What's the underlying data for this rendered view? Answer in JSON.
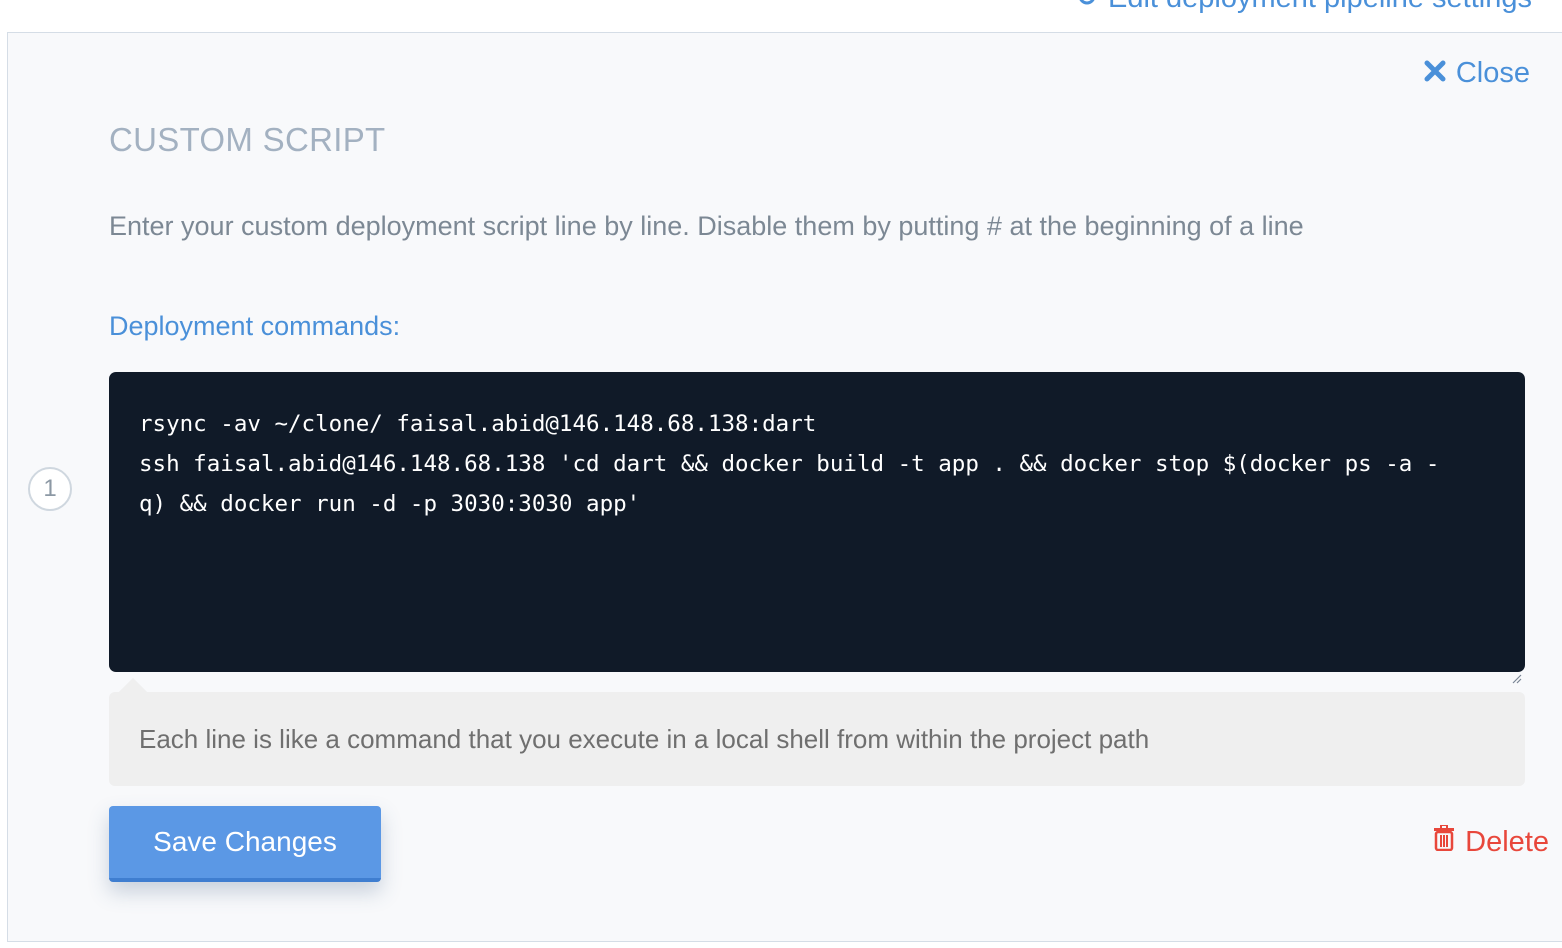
{
  "header": {
    "top_link_label": "Edit deployment pipeline settings",
    "top_link_icon": "settings-icon"
  },
  "panel": {
    "close_label": "Close",
    "close_icon": "close-icon",
    "title": "CUSTOM SCRIPT",
    "description": "Enter your custom deployment script line by line. Disable them by putting # at the beginning of a line",
    "commands_label": "Deployment commands:",
    "step_number": "1",
    "script_lines": [
      "rsync -av ~/clone/ faisal.abid@146.148.68.138:dart",
      "ssh faisal.abid@146.148.68.138 'cd dart && docker build -t app . && docker stop $(docker ps -a -",
      "q) && docker run -d -p 3030:3030 app'"
    ],
    "hint": "Each line is like a command that you execute in a local shell from within the project path",
    "save_label": "Save Changes",
    "delete_label": "Delete",
    "delete_icon": "trash-icon"
  },
  "colors": {
    "accent": "#4a90d9",
    "save_button": "#5b98e5",
    "danger": "#e8473b",
    "editor_bg": "#101a28"
  }
}
